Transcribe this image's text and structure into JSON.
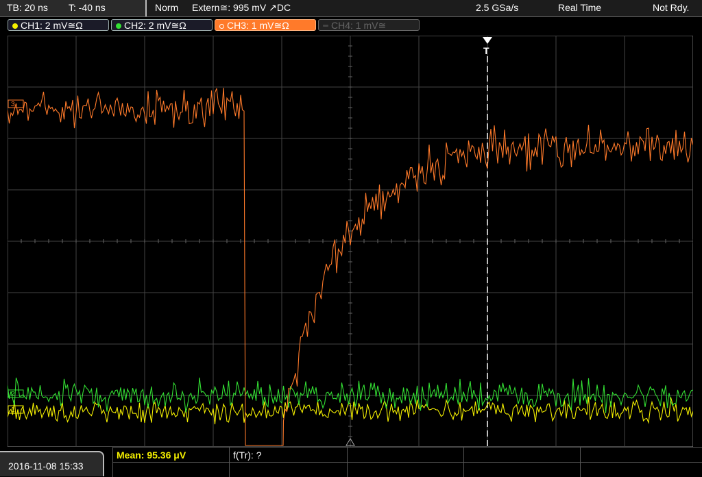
{
  "status_bar": {
    "timebase": "TB: 20 ns",
    "trigger_time": "T: -40 ns",
    "trigger_mode": "Norm",
    "trigger_source": "Extern≅: 995 mV ↗DC",
    "sample_rate": "2.5 GSa/s",
    "acquisition_mode": "Real Time",
    "acquisition_status": "Not Rdy."
  },
  "channels": [
    {
      "label": "CH1: 2 mV≅Ω",
      "color": "#f5f000"
    },
    {
      "label": "CH2: 2 mV≅Ω",
      "color": "#33e033"
    },
    {
      "label": "CH3: 1 mV≅Ω",
      "color": "#ff7a2a"
    },
    {
      "label": "CH4: 1 mV≅",
      "color": "#666666"
    }
  ],
  "markers": {
    "ch1": "1",
    "ch2": "2",
    "ch3": "3",
    "trigger": "T"
  },
  "measurements": {
    "mean": "Mean: 95.36 μV",
    "rise_time": "f(Tr): ?"
  },
  "footer": {
    "datetime": "2016-11-08 15:33"
  },
  "colors": {
    "ch1": "#f5f000",
    "ch2": "#33e033",
    "ch3": "#ff7a2a",
    "grid": "#555555",
    "background": "#000000"
  }
}
